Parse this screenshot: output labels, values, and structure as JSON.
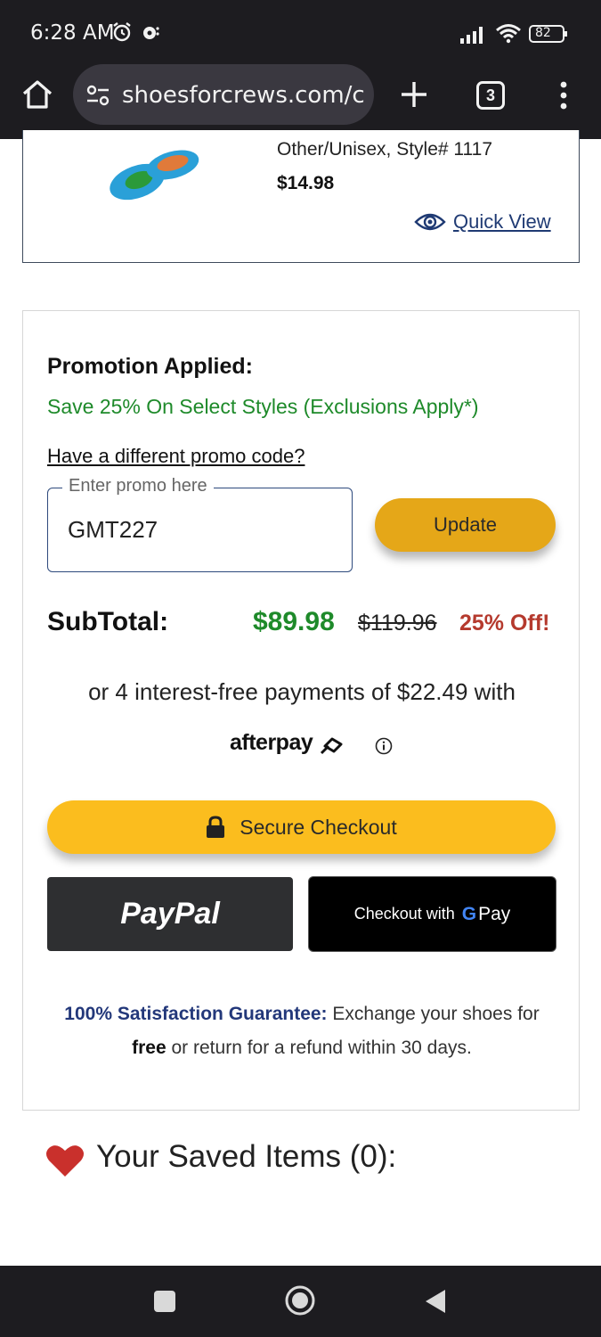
{
  "status_bar": {
    "time": "6:28 AM",
    "battery": "82"
  },
  "browser": {
    "url": "shoesforcrews.com/c",
    "tab_count": "3"
  },
  "product": {
    "meta": "Other/Unisex, Style# 1117",
    "price": "$14.98",
    "quick_view": "Quick View"
  },
  "promotion": {
    "title": "Promotion Applied:",
    "description": "Save 25% On Select Styles (Exclusions Apply*)",
    "change_link": "Have a different promo code?",
    "input_label": "Enter promo here",
    "input_value": "GMT227",
    "update_label": "Update"
  },
  "totals": {
    "label": "SubTotal:",
    "price": "$89.98",
    "original_price": "$119.96",
    "discount": "25% Off!"
  },
  "afterpay": {
    "text": "or 4 interest-free payments of $22.49 with",
    "logo": "afterpay"
  },
  "checkout": {
    "secure_label": "Secure Checkout",
    "paypal_label": "PayPal",
    "gpay_label": "Checkout with",
    "gpay_g": "G",
    "gpay_pay": "Pay"
  },
  "guarantee": {
    "strong": "100% Satisfaction Guarantee:",
    "text_1": " Exchange your shoes for ",
    "free": "free",
    "text_2": " or return for a refund within 30 days."
  },
  "saved": {
    "title": "Your Saved Items (0):"
  },
  "colors": {
    "accent_yellow": "#fbbd1e",
    "update_yellow": "#e5a718",
    "price_green": "#1e8a2a",
    "discount_red": "#b53a2e",
    "brand_navy": "#23387a"
  }
}
